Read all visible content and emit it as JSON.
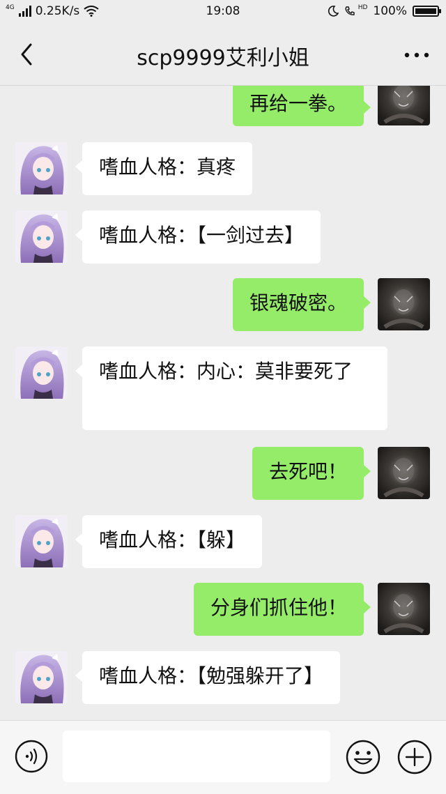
{
  "status_bar": {
    "network": "4G",
    "speed": "0.25K/s",
    "time": "19:08",
    "hd": "HD",
    "battery": "100%"
  },
  "nav": {
    "back_icon": "chevron-left-icon",
    "title": "scp9999艾利小姐",
    "more_icon": "more-dots-icon"
  },
  "messages": [
    {
      "side": "out",
      "text": "再给一拳。",
      "avatar": "dark-avatar"
    },
    {
      "side": "in",
      "text": "嗜血人格：真疼",
      "avatar": "girl-avatar"
    },
    {
      "side": "in",
      "text": "嗜血人格：【一剑过去】",
      "avatar": "girl-avatar"
    },
    {
      "side": "out",
      "text": "银魂破密。",
      "avatar": "dark-avatar"
    },
    {
      "side": "in",
      "text": "嗜血人格：内心：莫非要死了",
      "avatar": "girl-avatar"
    },
    {
      "side": "out",
      "text": "去死吧！",
      "avatar": "dark-avatar"
    },
    {
      "side": "in",
      "text": "嗜血人格：【躲】",
      "avatar": "girl-avatar"
    },
    {
      "side": "out",
      "text": "分身们抓住他！",
      "avatar": "dark-avatar"
    },
    {
      "side": "in",
      "text": "嗜血人格：【勉强躲开了】",
      "avatar": "girl-avatar"
    }
  ],
  "input_bar": {
    "voice_icon": "voice-icon",
    "placeholder": "",
    "emoji_icon": "emoji-icon",
    "plus_icon": "plus-icon"
  },
  "colors": {
    "background": "#ededed",
    "bubble_out": "#95ec69",
    "bubble_in": "#ffffff"
  }
}
